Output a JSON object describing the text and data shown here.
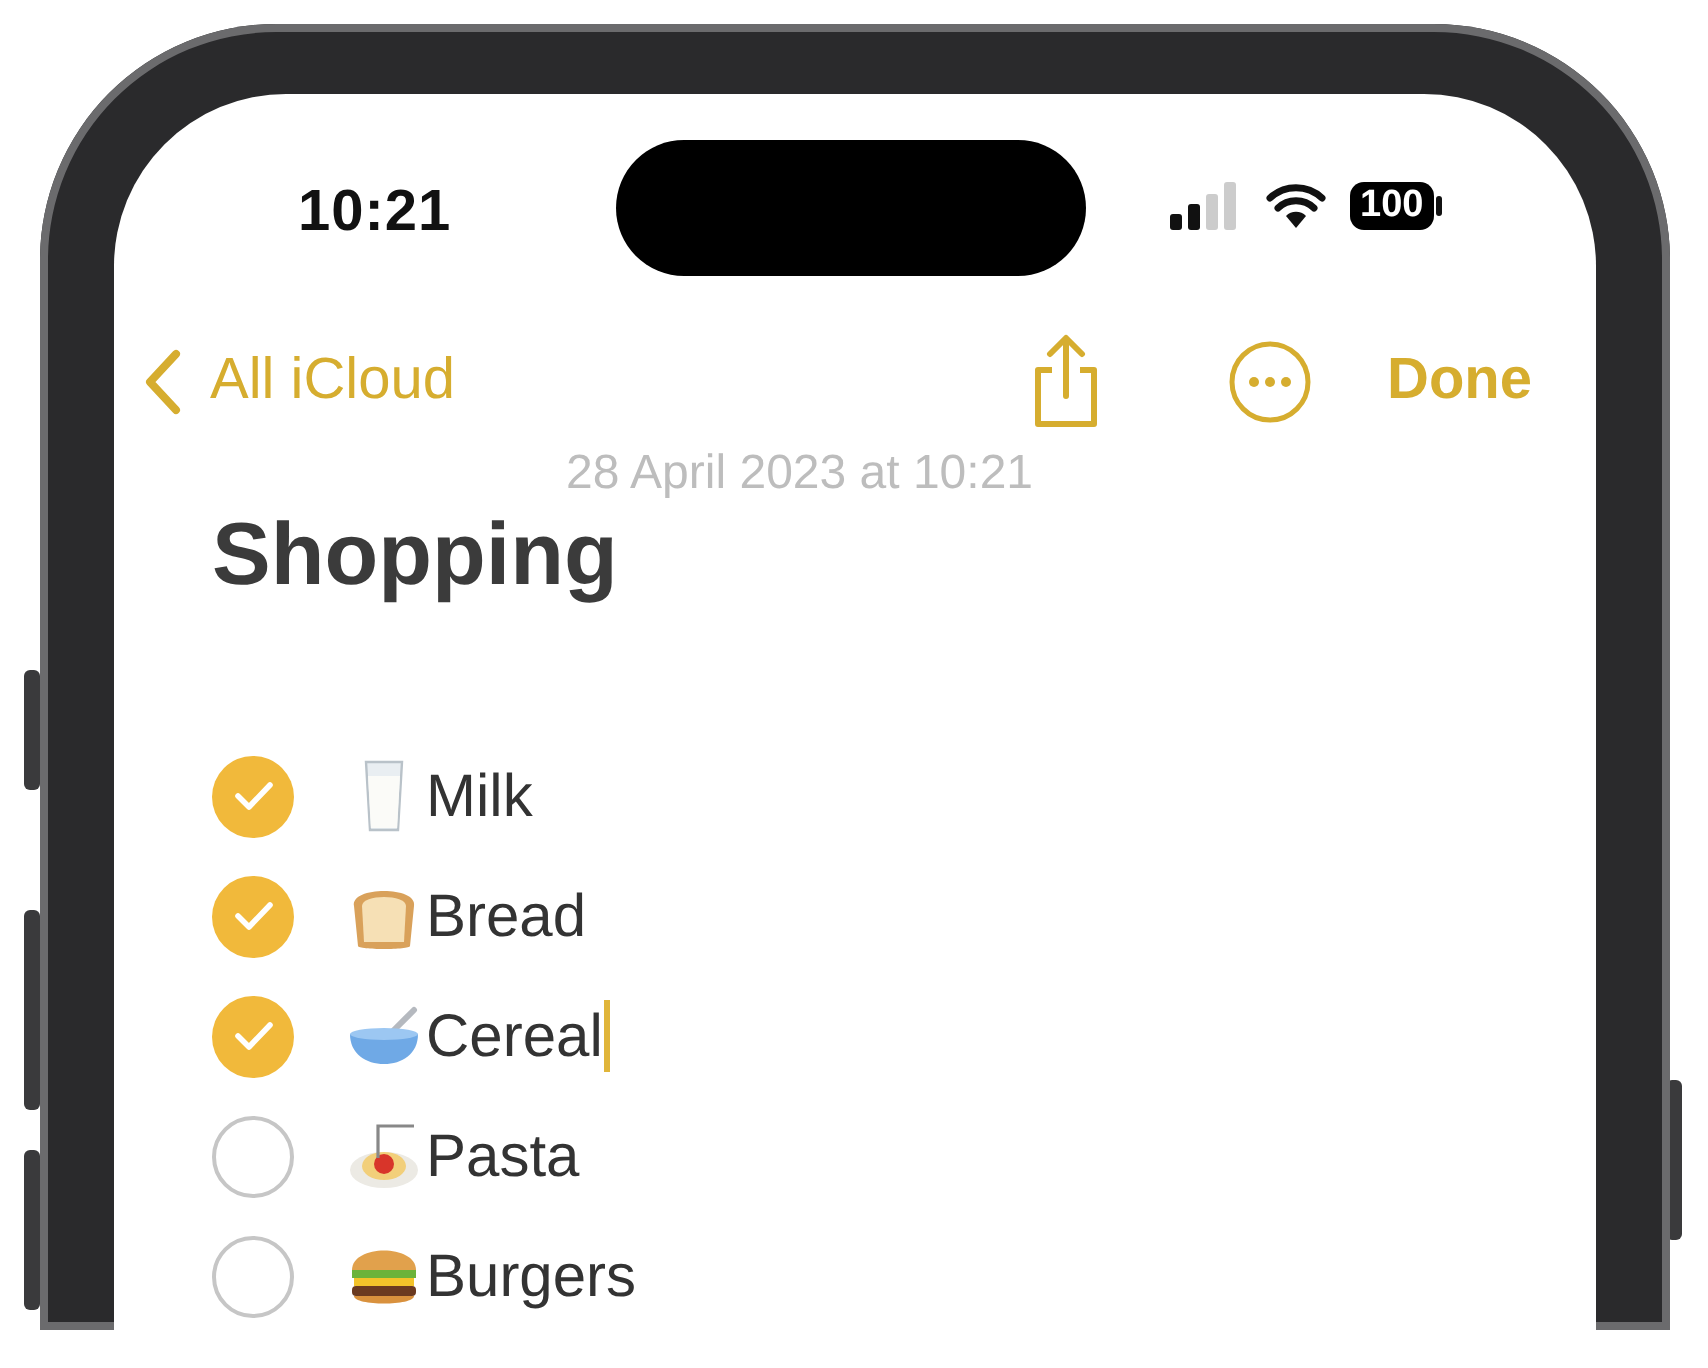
{
  "status_bar": {
    "time": "10:21",
    "battery": "100"
  },
  "nav": {
    "back_label": "All iCloud",
    "done_label": "Done"
  },
  "note": {
    "date": "28 April 2023 at 10:21",
    "title": "Shopping",
    "items": [
      {
        "label": "Milk",
        "checked": true,
        "cursor": false
      },
      {
        "label": "Bread",
        "checked": true,
        "cursor": false
      },
      {
        "label": "Cereal",
        "checked": true,
        "cursor": true
      },
      {
        "label": "Pasta",
        "checked": false,
        "cursor": false
      },
      {
        "label": "Burgers",
        "checked": false,
        "cursor": false
      }
    ]
  }
}
